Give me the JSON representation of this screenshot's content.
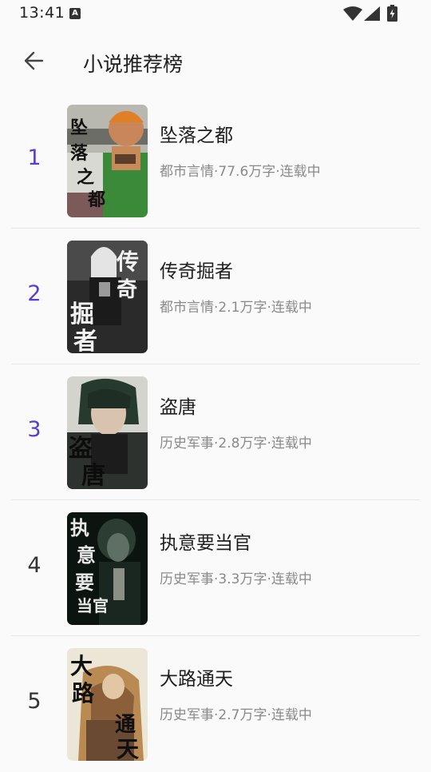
{
  "status_bar": {
    "time": "13:41",
    "notification_glyph": "A",
    "icons": [
      "wifi-icon",
      "signal-icon",
      "battery-charging-icon"
    ]
  },
  "app_bar": {
    "back_icon": "arrow-left-icon",
    "title": "小说推荐榜"
  },
  "colors": {
    "top_rank": "#5b3ccf",
    "rank": "#333333",
    "meta": "#8a8a8a"
  },
  "books": [
    {
      "rank": "1",
      "title": "坠落之都",
      "meta": "都市言情·77.6万字·连载中"
    },
    {
      "rank": "2",
      "title": "传奇掘者",
      "meta": "都市言情·2.1万字·连载中"
    },
    {
      "rank": "3",
      "title": "盗唐",
      "meta": "历史军事·2.8万字·连载中"
    },
    {
      "rank": "4",
      "title": "执意要当官",
      "meta": "历史军事·3.3万字·连载中"
    },
    {
      "rank": "5",
      "title": "大路通天",
      "meta": "历史军事·2.7万字·连载中"
    }
  ]
}
